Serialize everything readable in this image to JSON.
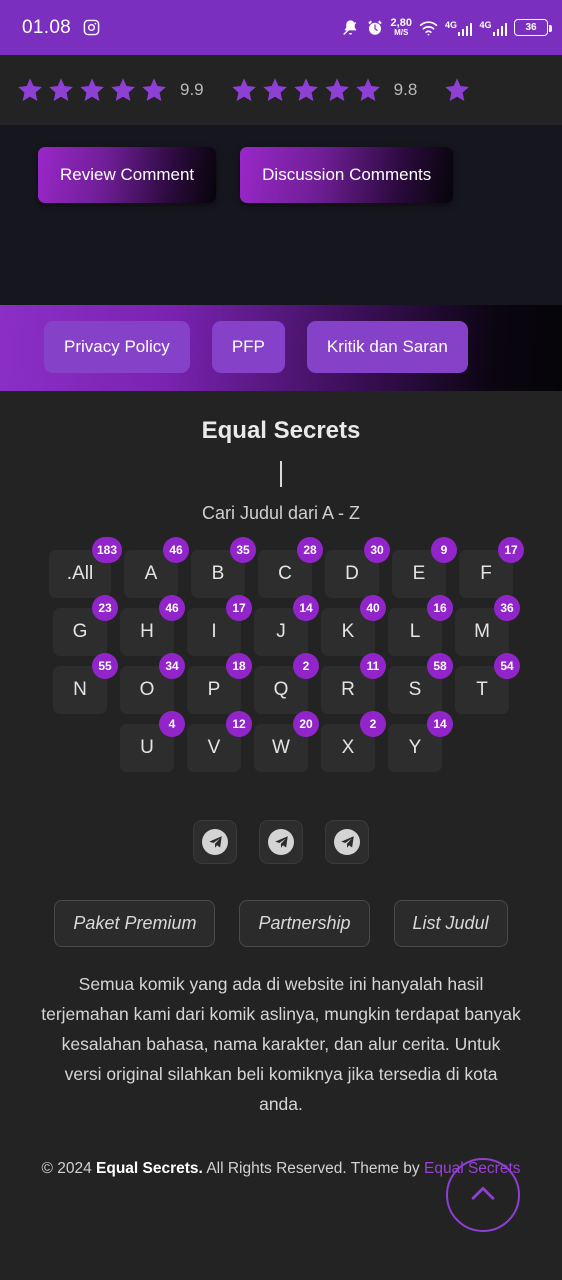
{
  "statusbar": {
    "clock": "01.08",
    "instagram_icon": "instagram-icon",
    "bell_off_icon": "bell-off-icon",
    "alarm_icon": "alarm-clock-icon",
    "speed_value": "2,80",
    "speed_unit": "M/S",
    "wifi_icon": "wifi-icon",
    "net1_label": "4G",
    "net2_label": "4G",
    "battery_level": "36"
  },
  "ratings": {
    "groups": [
      {
        "stars": 5,
        "score": "9.9"
      },
      {
        "stars": 5,
        "score": "9.8"
      },
      {
        "stars": 1,
        "score": ""
      }
    ]
  },
  "comment_buttons": {
    "review": "Review Comment",
    "discussion": "Discussion Comments"
  },
  "nav_band": {
    "items": [
      {
        "label": "Privacy Policy"
      },
      {
        "label": "PFP"
      },
      {
        "label": "Kritik dan Saran"
      }
    ]
  },
  "footer": {
    "site_title": "Equal Secrets",
    "search_value": "",
    "search_placeholder": "",
    "subtitle": "Cari Judul dari A - Z",
    "alphabet": [
      {
        "label": ".All",
        "count": "183",
        "wide": true
      },
      {
        "label": "A",
        "count": "46"
      },
      {
        "label": "B",
        "count": "35"
      },
      {
        "label": "C",
        "count": "28"
      },
      {
        "label": "D",
        "count": "30"
      },
      {
        "label": "E",
        "count": "9"
      },
      {
        "label": "F",
        "count": "17"
      },
      {
        "label": "G",
        "count": "23"
      },
      {
        "label": "H",
        "count": "46"
      },
      {
        "label": "I",
        "count": "17"
      },
      {
        "label": "J",
        "count": "14"
      },
      {
        "label": "K",
        "count": "40"
      },
      {
        "label": "L",
        "count": "16"
      },
      {
        "label": "M",
        "count": "36"
      },
      {
        "label": "N",
        "count": "55"
      },
      {
        "label": "O",
        "count": "34"
      },
      {
        "label": "P",
        "count": "18"
      },
      {
        "label": "Q",
        "count": "2"
      },
      {
        "label": "R",
        "count": "11"
      },
      {
        "label": "S",
        "count": "58"
      },
      {
        "label": "T",
        "count": "54"
      },
      {
        "label": "U",
        "count": "4"
      },
      {
        "label": "V",
        "count": "12"
      },
      {
        "label": "W",
        "count": "20"
      },
      {
        "label": "X",
        "count": "2"
      },
      {
        "label": "Y",
        "count": "14"
      }
    ],
    "socials": [
      {
        "icon": "telegram-icon"
      },
      {
        "icon": "telegram-icon"
      },
      {
        "icon": "telegram-icon"
      }
    ],
    "pills": [
      {
        "label": "Paket Premium"
      },
      {
        "label": "Partnership"
      },
      {
        "label": "List Judul"
      }
    ],
    "disclaimer": "Semua komik yang ada di website ini hanyalah hasil terjemahan kami dari komik aslinya, mungkin terdapat banyak kesalahan bahasa, nama karakter, dan alur cerita. Untuk versi original silahkan beli komiknya jika tersedia di kota anda.",
    "copyright": {
      "symbol": "©",
      "year": "2024",
      "brand": "Equal Secrets.",
      "rights": "All Rights Reserved. Theme by",
      "theme_link": "Equal Secrets"
    },
    "scroll_top_icon": "chevron-up-icon"
  },
  "colors": {
    "accent_purple": "#9225c9",
    "status_purple": "#7b2fbe",
    "star_purple": "#8e3fd4",
    "page_bg": "#232323",
    "dark_section": "#16161e",
    "link_purple": "#9b3fd8"
  }
}
